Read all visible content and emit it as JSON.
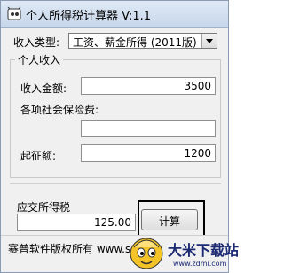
{
  "window": {
    "title": "个人所得税计算器 V:1.1"
  },
  "income_type": {
    "label": "收入类型:",
    "selected": "工资、薪金所得 (2011版)"
  },
  "personal_income": {
    "legend": "个人收入",
    "income_amount_label": "收入金额:",
    "income_amount_value": "3500",
    "social_insurance_label": "各项社会保险费:",
    "social_insurance_value": "",
    "threshold_label": "起征额:",
    "threshold_value": "1200"
  },
  "tax": {
    "label": "应交所得税",
    "value": "125.00",
    "calc_label": "计算"
  },
  "status": {
    "copyright": "赛普软件版权所有 www.s"
  },
  "watermark": {
    "title": "大米下载站",
    "url": "www.zdmi.com"
  },
  "icons": [
    "app-icon",
    "chevron-down-icon",
    "watermark-logo-icon"
  ]
}
